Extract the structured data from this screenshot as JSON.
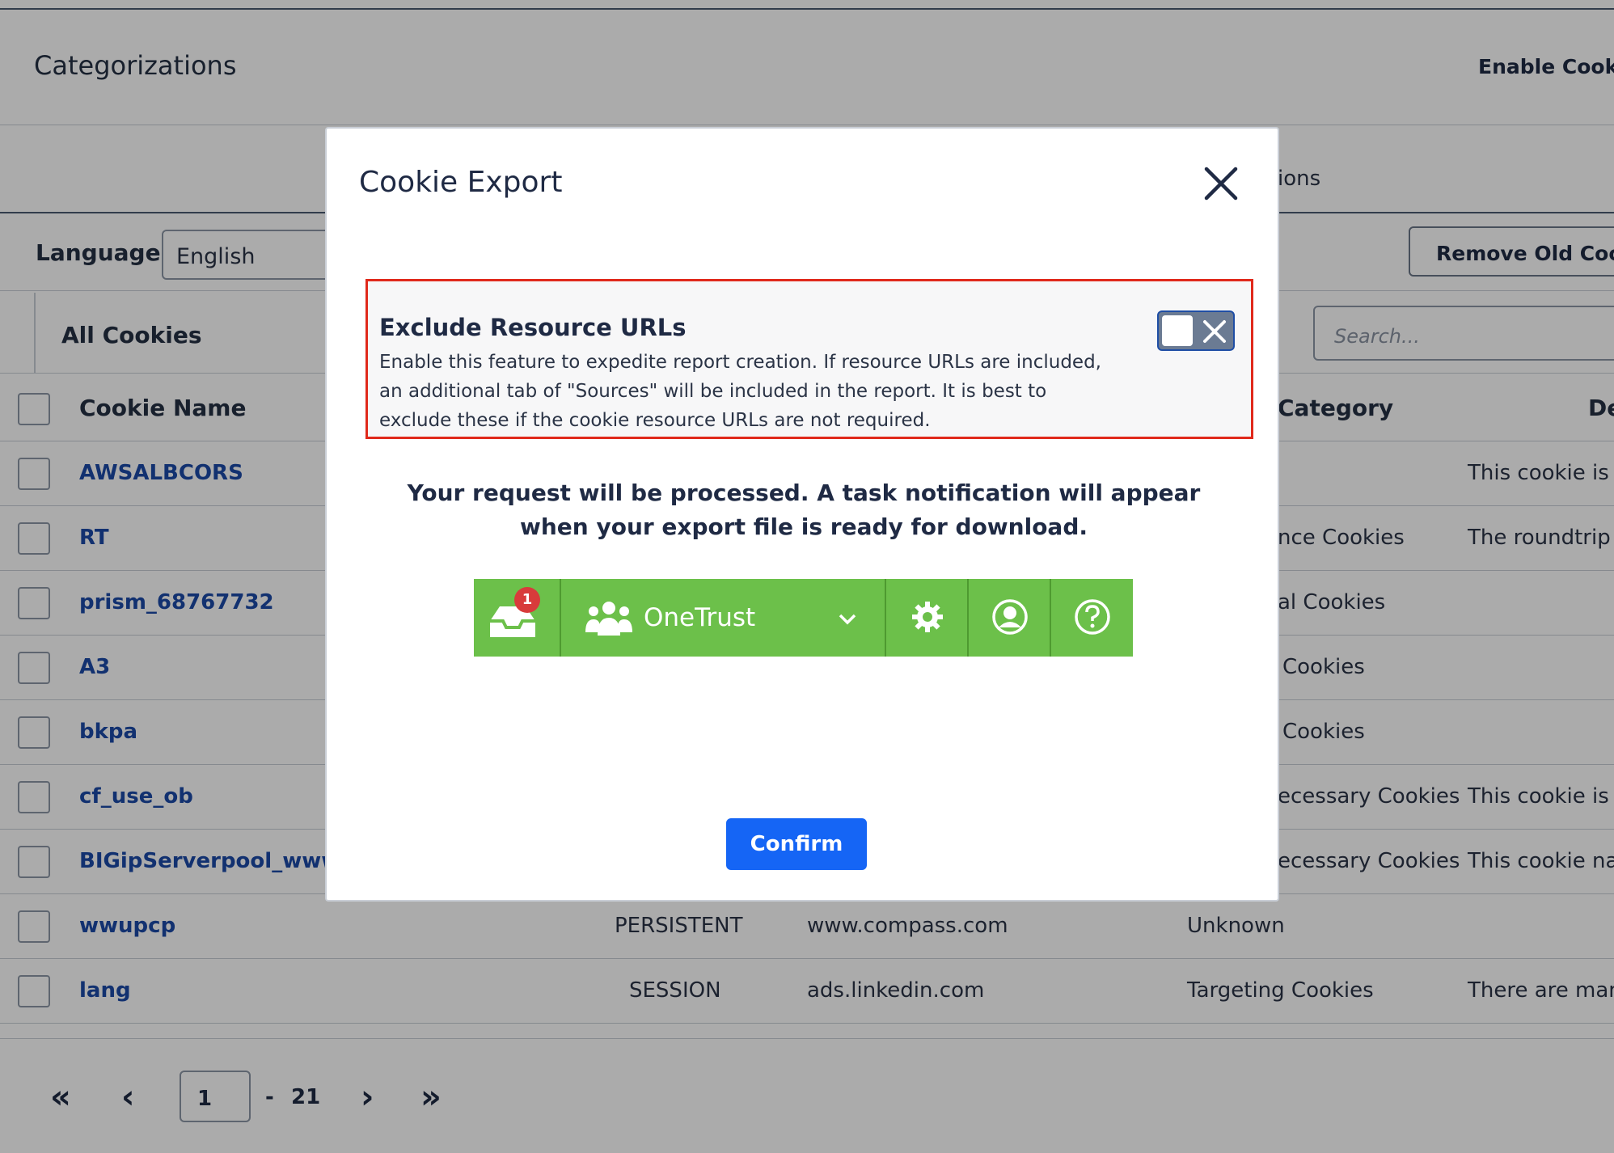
{
  "background": {
    "section_title": "Categorizations",
    "enable_link": "Enable Cooki",
    "tab_fragment": "ions",
    "language_label": "Language",
    "language_value": "English",
    "remove_button": "Remove Old Cook",
    "all_cookies": "All Cookies",
    "search_placeholder": "Search...",
    "table": {
      "headers": {
        "name": "Cookie Name",
        "category": "Category",
        "description": "De"
      },
      "rows": [
        {
          "name": "AWSALBCORS",
          "type": "",
          "host": "",
          "category": "",
          "description": "This cookie is m"
        },
        {
          "name": "RT",
          "type": "",
          "host": "",
          "category": "nce Cookies",
          "description": "The roundtrip ("
        },
        {
          "name": "prism_68767732",
          "type": "",
          "host": "",
          "category": "al Cookies",
          "description": ""
        },
        {
          "name": "A3",
          "type": "",
          "host": "",
          "category": "Cookies",
          "description": ""
        },
        {
          "name": "bkpa",
          "type": "",
          "host": "",
          "category": "Cookies",
          "description": ""
        },
        {
          "name": "cf_use_ob",
          "type": "",
          "host": "",
          "category": "ecessary Cookies",
          "description": "This cookie is a"
        },
        {
          "name": "BIGipServerpool_www.w",
          "type": "",
          "host": "",
          "category": "ecessary Cookies",
          "description": "This cookie nan"
        },
        {
          "name": "wwupcp",
          "type": "PERSISTENT",
          "host": "www.compass.com",
          "category": "Unknown",
          "description": ""
        },
        {
          "name": "lang",
          "type": "SESSION",
          "host": "ads.linkedin.com",
          "category": "Targeting Cookies",
          "description": "There are many"
        }
      ]
    },
    "pagination": {
      "current_page": "1",
      "separator": "-",
      "total_pages": "21"
    }
  },
  "modal": {
    "title": "Cookie Export",
    "option": {
      "title": "Exclude Resource URLs",
      "description": "Enable this feature to expedite report creation. If resource URLs are included, an additional tab of \"Sources\" will be included in the report. It is best to exclude these if the cookie resource URLs are not required.",
      "toggle_on": false
    },
    "message": "Your request will be processed. A task notification will appear when your export file is ready for download.",
    "onetrust_bar": {
      "brand": "OneTrust",
      "notification_count": "1",
      "bar_color": "#6cc04a"
    },
    "confirm_label": "Confirm"
  },
  "colors": {
    "accent_blue": "#1565f5",
    "link_blue": "#1b4aa8",
    "highlight_red": "#e0291b"
  }
}
